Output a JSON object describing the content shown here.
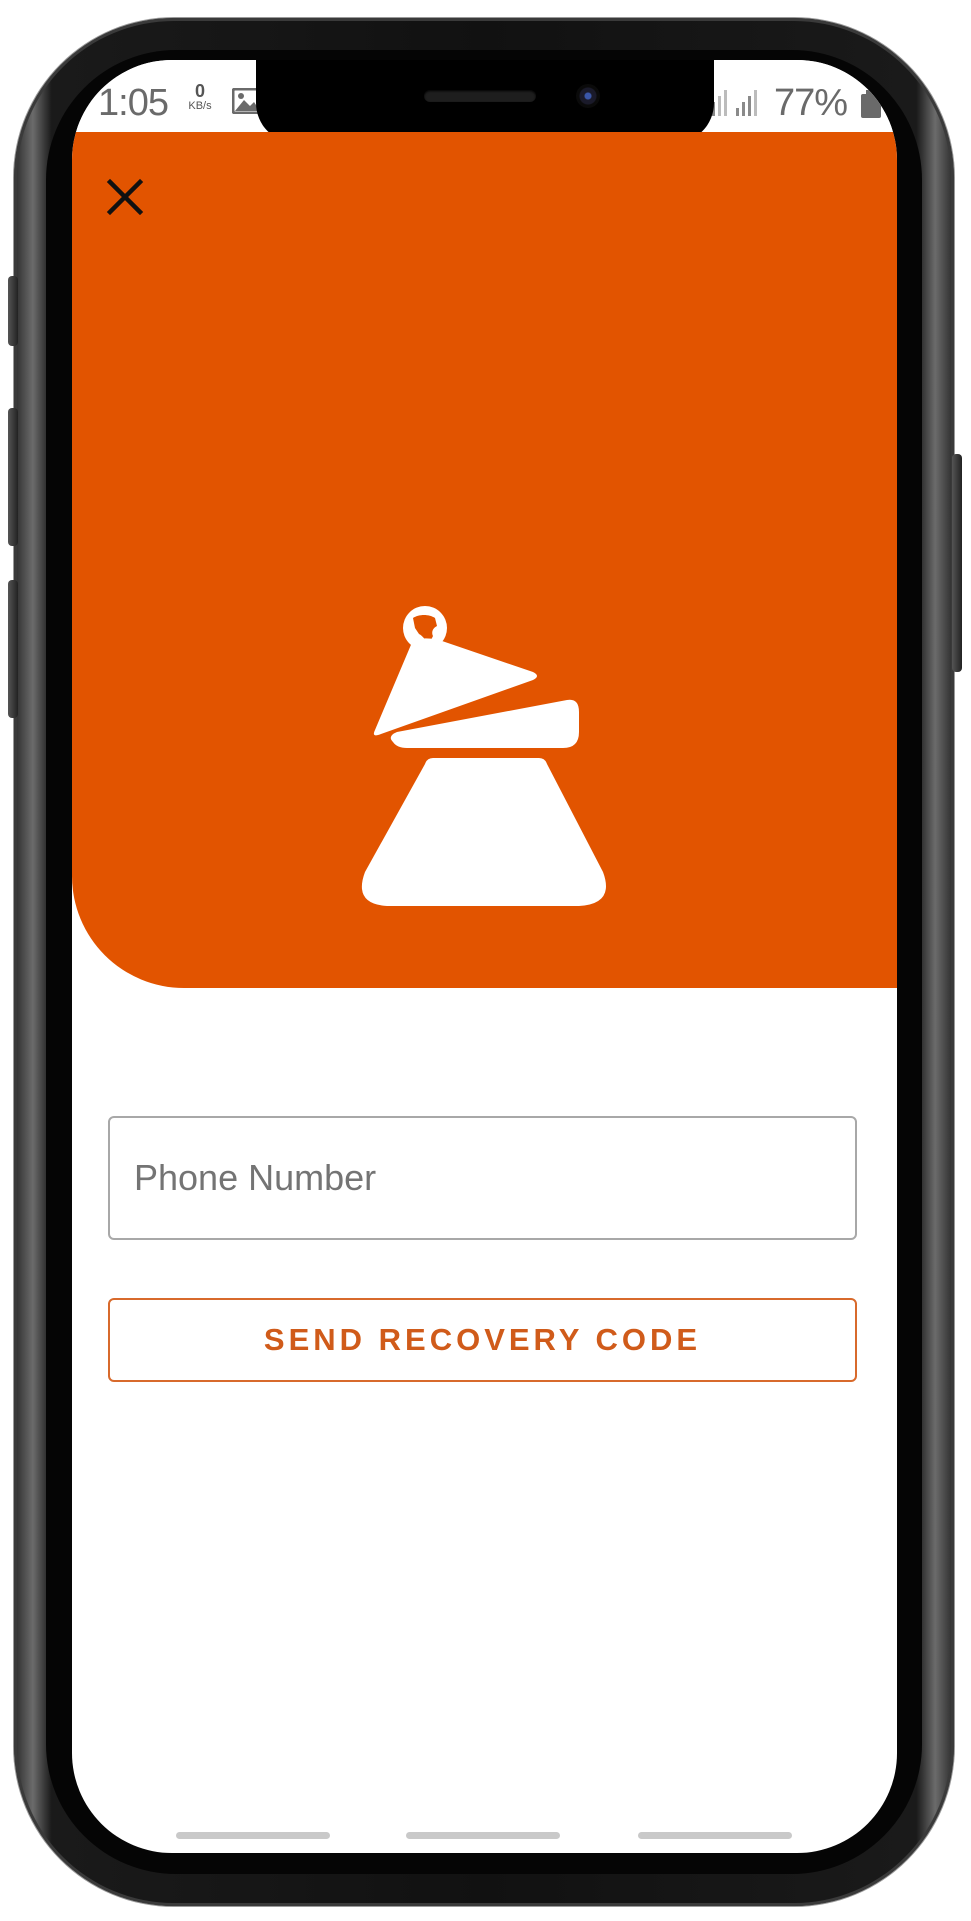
{
  "status_bar": {
    "time": "1:05",
    "net_speed_value": "0",
    "net_speed_unit": "KB/s",
    "battery_percent": "77%",
    "gallery_icon": "image-icon",
    "signal_icon": "signal-icon",
    "battery_icon": "battery-icon"
  },
  "hero": {
    "background_color": "#e25400",
    "close_icon": "close-icon",
    "logo_icon": "pot-with-globe-logo"
  },
  "form": {
    "phone_placeholder": "Phone Number",
    "phone_value": "",
    "send_button_label": "SEND RECOVERY CODE",
    "accent_color": "#d05b1a"
  }
}
